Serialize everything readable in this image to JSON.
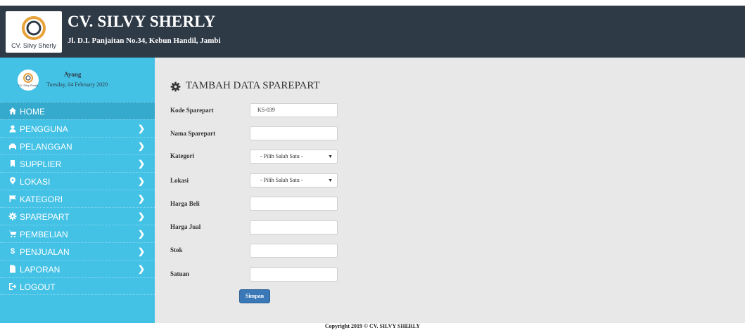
{
  "header": {
    "company": "CV. SILVY SHERLY",
    "address": "Jl. D.I. Panjaitan No.34, Kebun Handil, Jambi",
    "logo_text": "CV. Silvy Sherly"
  },
  "user": {
    "name": "Ayong",
    "date": "Tuesday, 04 February 2020",
    "avatar_text": "CV. Silvy Sherly"
  },
  "menu": [
    {
      "label": "HOME",
      "icon": "home-icon",
      "chevron": false
    },
    {
      "label": "PENGGUNA",
      "icon": "user-icon",
      "chevron": true
    },
    {
      "label": "PELANGGAN",
      "icon": "car-icon",
      "chevron": true
    },
    {
      "label": "SUPPLIER",
      "icon": "bookmark-icon",
      "chevron": true
    },
    {
      "label": "LOKASI",
      "icon": "map-marker-icon",
      "chevron": true
    },
    {
      "label": "KATEGORI",
      "icon": "flag-icon",
      "chevron": true
    },
    {
      "label": "SPAREPART",
      "icon": "cog-icon",
      "chevron": true
    },
    {
      "label": "PEMBELIAN",
      "icon": "cart-icon",
      "chevron": true
    },
    {
      "label": "PENJUALAN",
      "icon": "dollar-icon",
      "chevron": true
    },
    {
      "label": "LAPORAN",
      "icon": "file-icon",
      "chevron": true
    },
    {
      "label": "LOGOUT",
      "icon": "logout-icon",
      "chevron": false
    }
  ],
  "page_title": "TAMBAH DATA SPAREPART",
  "form": {
    "kode": {
      "label": "Kode Sparepart",
      "value": "KS-039"
    },
    "nama": {
      "label": "Nama Sparepart",
      "value": ""
    },
    "kategori": {
      "label": "Kategori",
      "value": "- Pilih Salah Satu -"
    },
    "lokasi": {
      "label": "Lokasi",
      "value": "- Pilih Salah Satu -"
    },
    "harga_beli": {
      "label": "Harga Beli",
      "value": ""
    },
    "harga_jual": {
      "label": "Harga Jual",
      "value": ""
    },
    "stok": {
      "label": "Stok",
      "value": ""
    },
    "satuan": {
      "label": "Satuan",
      "value": ""
    },
    "submit": "Simpan"
  },
  "footer": "Copyright 2019 © CV. SILVY SHERLY",
  "colors": {
    "header": "#2f3a47",
    "sidebar": "#44c2e6",
    "content": "#e8e8e8",
    "button": "#3a78b8"
  }
}
